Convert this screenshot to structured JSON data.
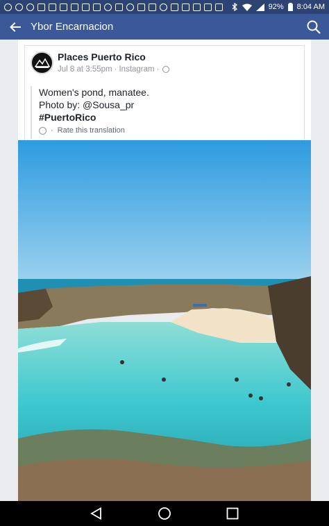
{
  "status_bar": {
    "battery": "92%",
    "time": "8:04 AM",
    "notification_icons": [
      "flame-icon",
      "flame-icon",
      "messenger-icon",
      "gmail-icon",
      "gmail-icon",
      "gmail-icon",
      "gmail-icon",
      "gmail-icon",
      "image-icon",
      "flame-icon",
      "facebook-icon",
      "pinterest-icon",
      "youtube-icon",
      "facebook-icon",
      "tv-icon",
      "facebook-icon",
      "news-icon",
      "facebook-icon",
      "check-icon",
      "gallery-icon"
    ],
    "system_icons": [
      "bluetooth-icon",
      "wifi-icon",
      "signal-icon",
      "battery-icon"
    ]
  },
  "app_bar": {
    "title": "Ybor Encarnacion"
  },
  "post": {
    "page_name": "Places Puerto Rico",
    "timestamp": "Jul 8 at 3:55pm",
    "separator": "·",
    "source": "Instagram",
    "text_line1": "Women's pond, manatee.",
    "text_line2": "Photo by: @Sousa_pr",
    "hashtag": "#PuertoRico",
    "translation_label": "Rate this translation"
  },
  "colors": {
    "status_bar": "#2d4373",
    "app_bar": "#3b5998",
    "sky_top": "#2e9be0",
    "sea": "#3ec8d0"
  }
}
